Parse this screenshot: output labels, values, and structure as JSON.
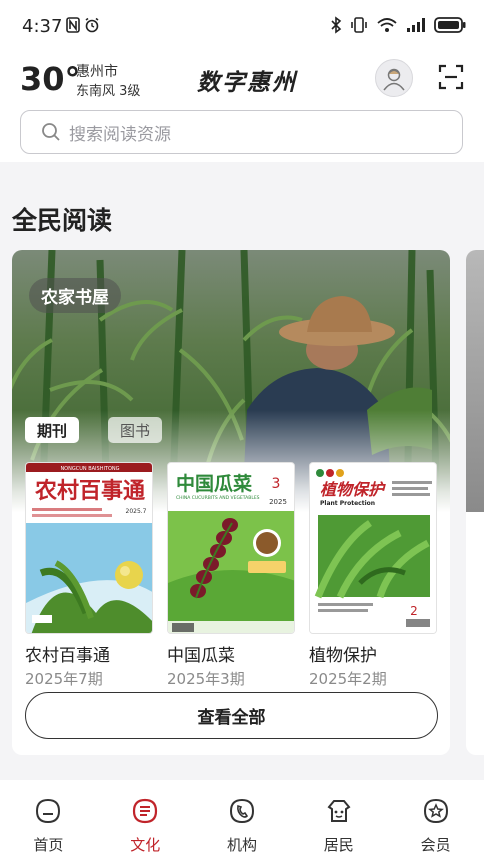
{
  "status_bar": {
    "time": "4:37",
    "left_icons": [
      "nfc-icon",
      "alarm-icon"
    ],
    "right_icons": [
      "bluetooth-icon",
      "vibrate-icon",
      "wifi-icon",
      "signal-icon",
      "battery-icon"
    ]
  },
  "header": {
    "weather": {
      "temp": "30°",
      "city": "惠州市",
      "wind": "东南风 3级"
    },
    "title": "数字惠州",
    "avatar_icon": "user-avatar-icon",
    "scan_icon": "scan-icon"
  },
  "search": {
    "placeholder": "搜索阅读资源",
    "icon": "search-icon"
  },
  "section": {
    "title": "全民阅读",
    "card": {
      "badge": "农家书屋",
      "tabs": [
        {
          "label": "期刊",
          "active": true
        },
        {
          "label": "图书",
          "active": false
        }
      ],
      "books": [
        {
          "title": "农村百事通",
          "issue": "2025年7期",
          "cover_title": "农村百事通",
          "cover_header": "NONGCUN BAISHITONG",
          "cover_issue": "2025.7"
        },
        {
          "title": "中国瓜菜",
          "issue": "2025年3期",
          "cover_title": "中国瓜菜",
          "cover_subtitle": "CHINA CUCURBITS AND VEGETABLES",
          "cover_issue_num": "3",
          "cover_year": "2025"
        },
        {
          "title": "植物保护",
          "issue": "2025年2期",
          "cover_title": "植物保护",
          "cover_subtitle": "Plant Protection",
          "cover_issue_num": "2"
        }
      ],
      "view_all_label": "查看全部"
    }
  },
  "bottom_nav": {
    "items": [
      {
        "label": "首页",
        "icon": "home-icon",
        "active": false
      },
      {
        "label": "文化",
        "icon": "culture-icon",
        "active": true
      },
      {
        "label": "机构",
        "icon": "institution-icon",
        "active": false
      },
      {
        "label": "居民",
        "icon": "resident-icon",
        "active": false
      },
      {
        "label": "会员",
        "icon": "member-icon",
        "active": false
      }
    ]
  },
  "colors": {
    "accent": "#c0242a",
    "text": "#222222",
    "muted": "#8a8a8a"
  }
}
